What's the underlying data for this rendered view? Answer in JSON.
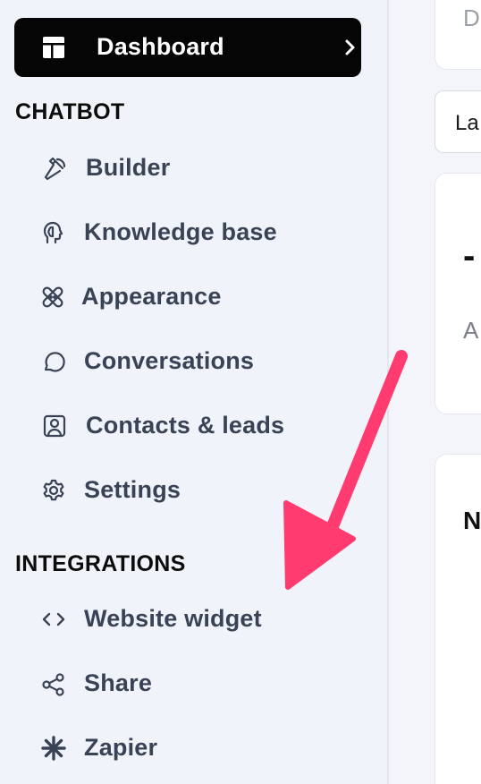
{
  "sidebar": {
    "dashboard": {
      "label": "Dashboard",
      "icon": "dashboard-layout-icon",
      "chevron_icon": "chevron-right-icon"
    },
    "sections": [
      {
        "title": "CHATBOT",
        "items": [
          {
            "label": "Builder",
            "icon": "hammer-icon"
          },
          {
            "label": "Knowledge base",
            "icon": "brain-head-icon"
          },
          {
            "label": "Appearance",
            "icon": "bandage-icon"
          },
          {
            "label": "Conversations",
            "icon": "chat-bubble-icon"
          },
          {
            "label": "Contacts & leads",
            "icon": "contact-card-icon"
          },
          {
            "label": "Settings",
            "icon": "gear-icon"
          }
        ]
      },
      {
        "title": "INTEGRATIONS",
        "items": [
          {
            "label": "Website widget",
            "icon": "code-brackets-icon"
          },
          {
            "label": "Share",
            "icon": "share-icon"
          },
          {
            "label": "Zapier",
            "icon": "zapier-asterisk-icon"
          }
        ]
      }
    ]
  },
  "main": {
    "top_card_text": "D",
    "date_select": "La",
    "stat_card": {
      "value": "-",
      "label": "A"
    },
    "panel_title": "N"
  },
  "overlay": {
    "arrow_color": "#ff3b6f"
  },
  "colors": {
    "sidebar_bg": "#f0f3f9",
    "text": "#3a4356",
    "active_bg": "#050505"
  }
}
